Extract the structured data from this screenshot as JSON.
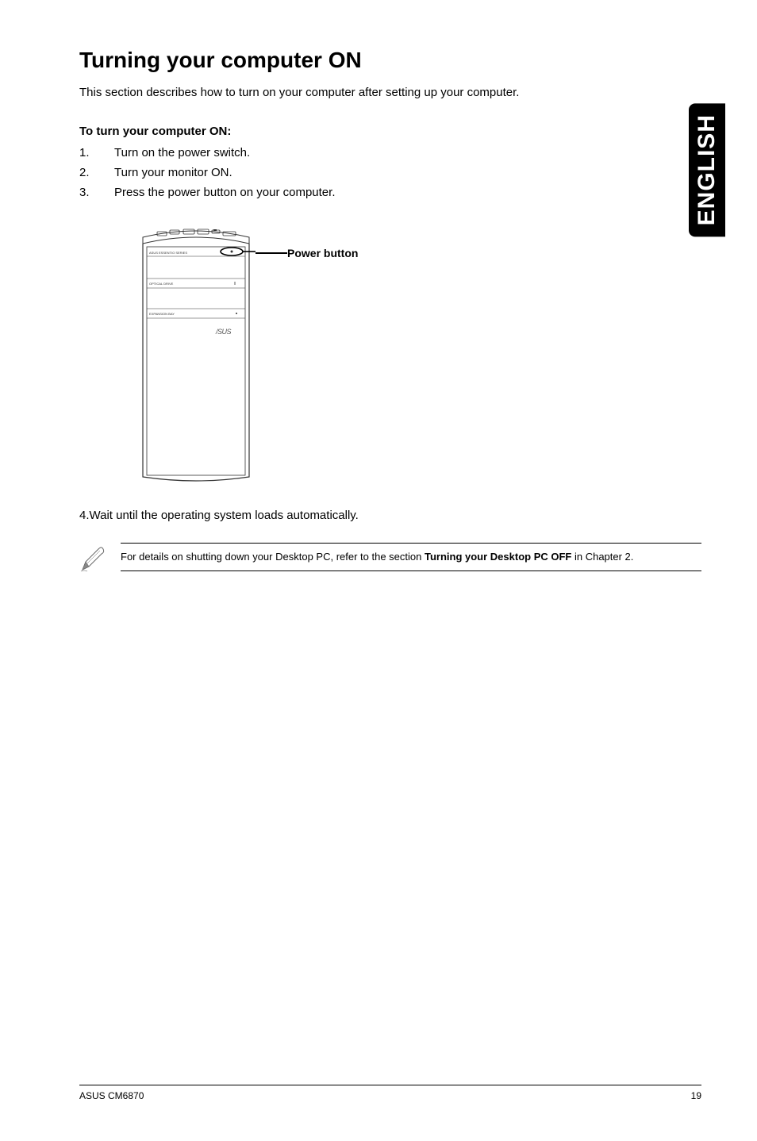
{
  "side_tab": "ENGLISH",
  "title": "Turning your computer ON",
  "intro": "This section describes how to turn on your computer after setting up your computer.",
  "subhead": "To turn your computer ON:",
  "steps": [
    {
      "num": "1.",
      "text": "Turn on the power switch."
    },
    {
      "num": "2.",
      "text": "Turn your monitor ON."
    },
    {
      "num": "3.",
      "text": "Press the power button on your computer."
    }
  ],
  "tower": {
    "power_label": "Power button",
    "optical_label": "OPTICAL DRIVE",
    "expansion_label": "EXPANSION BAY",
    "series_label": "ASUS ESSENTIO SERIES",
    "logo_text": "/SUS"
  },
  "step4": {
    "num": "4.",
    "text": "Wait until the operating system loads automatically."
  },
  "note": {
    "pre": "For details on shutting down your Desktop PC, refer to the section ",
    "bold": "Turning your Desktop PC OFF",
    "post": " in Chapter 2."
  },
  "footer": {
    "left": "ASUS CM6870",
    "right": "19"
  }
}
